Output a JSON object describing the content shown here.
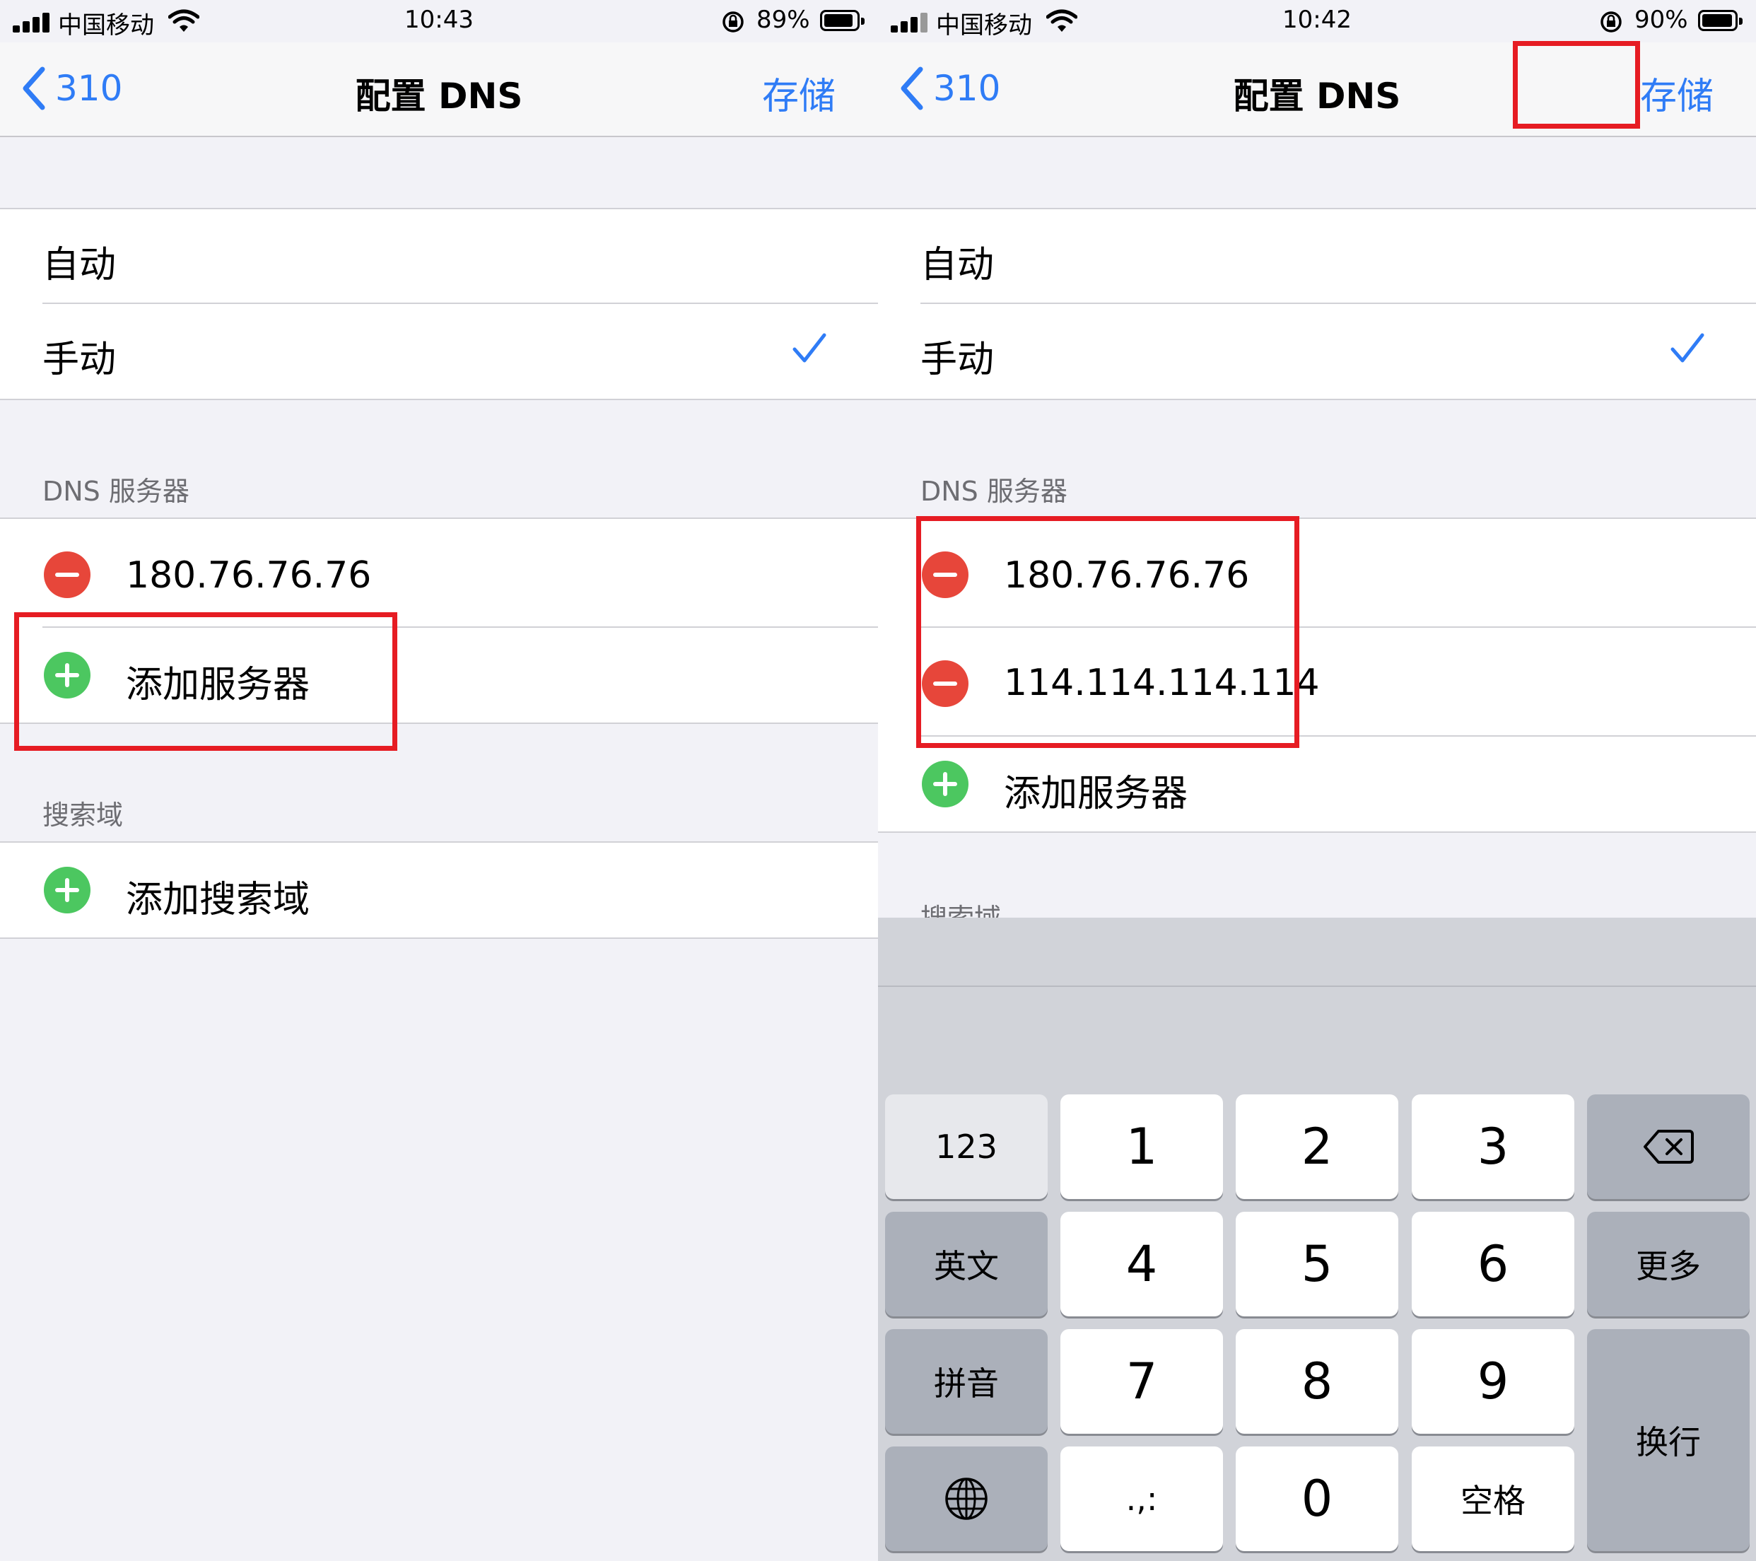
{
  "left": {
    "status": {
      "carrier": "中国移动",
      "time": "10:43",
      "battery": "89%",
      "battery_level": 0.89
    },
    "nav": {
      "back": "310",
      "title": "配置 DNS",
      "save": "存储"
    },
    "mode": {
      "auto": "自动",
      "manual": "手动",
      "selected": "manual"
    },
    "dns_header": "DNS 服务器",
    "dns_servers": [
      "180.76.76.76"
    ],
    "add_server": "添加服务器",
    "search_header": "搜索域",
    "add_search": "添加搜索域"
  },
  "right": {
    "status": {
      "carrier": "中国移动",
      "time": "10:42",
      "battery": "90%",
      "battery_level": 0.9
    },
    "nav": {
      "back": "310",
      "title": "配置 DNS",
      "save": "存储"
    },
    "mode": {
      "auto": "自动",
      "manual": "手动",
      "selected": "manual"
    },
    "dns_header": "DNS 服务器",
    "dns_servers": [
      "180.76.76.76",
      "114.114.114.114"
    ],
    "add_server": "添加服务器",
    "search_header": "搜索域",
    "keyboard": {
      "keys": {
        "num_toggle": "123",
        "k1": "1",
        "k2": "2",
        "k3": "3",
        "en": "英文",
        "k4": "4",
        "k5": "5",
        "k6": "6",
        "more": "更多",
        "pinyin": "拼音",
        "k7": "7",
        "k8": "8",
        "k9": "9",
        "return": "换行",
        "punct": ".,:",
        "k0": "0",
        "space": "空格"
      }
    }
  },
  "colors": {
    "accent": "#2f7cf6",
    "highlight": "#e61c23",
    "minus": "#e7463a",
    "plus": "#4cc760"
  }
}
